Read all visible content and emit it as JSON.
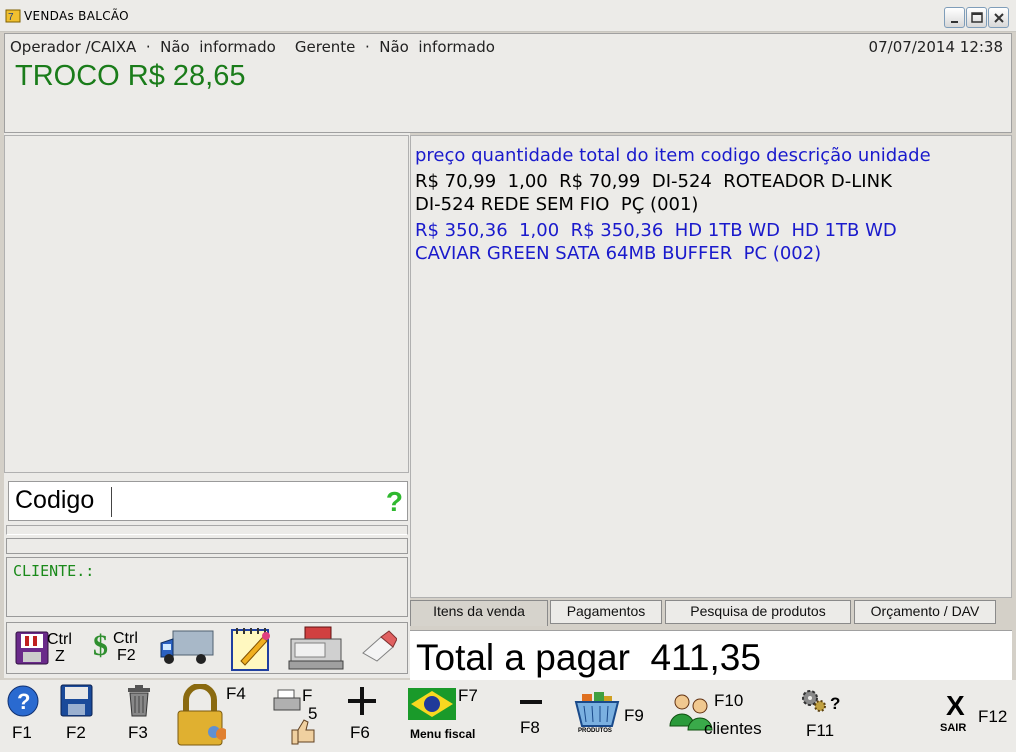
{
  "window": {
    "title": "VENDAs BALCÃO",
    "controls": [
      "minimize",
      "maximize",
      "close"
    ]
  },
  "header": {
    "operator_info": "Operador /CAIXA  ·  Não  informado    Gerente  ·  Não  informado",
    "datetime": "07/07/2014  12:38",
    "troco": "TROCO R$ 28,65"
  },
  "items": {
    "header": "preço quantidade total do item codigo descrição unidade",
    "rows": [
      {
        "line1": "R$ 70,99  1,00  R$ 70,99  DI-524  ROTEADOR D-LINK",
        "line2": "DI-524 REDE SEM FIO  PÇ (001)"
      },
      {
        "line1": "R$ 350,36  1,00  R$ 350,36  HD 1TB WD  HD 1TB WD",
        "line2": "CAVIAR GREEN SATA 64MB BUFFER  PC (002)"
      }
    ]
  },
  "tabs": [
    "Itens da venda",
    "Pagamentos",
    "Pesquisa de produtos",
    "Orçamento / DAV"
  ],
  "total": {
    "label": "Total a pagar  411,35"
  },
  "codigo": {
    "label": "Codigo",
    "help": "?"
  },
  "cliente": {
    "label": "CLIENTE.:"
  },
  "left_toolbar": {
    "ctrl_z": [
      "Ctrl",
      "Z"
    ],
    "ctrl_f2": [
      "Ctrl",
      "F2"
    ]
  },
  "fkeys": {
    "f1": "F1",
    "f2": "F2",
    "f3": "F3",
    "f4": "F4",
    "f5_top": "F",
    "f5_bottom": "5",
    "f6": "F6",
    "f7": "F7",
    "f7_caption": "Menu fiscal",
    "f8": "F8",
    "f9": "F9",
    "f9_caption": "PRODUTOS",
    "f10": "F10",
    "f10_caption": "clientes",
    "f11": "F11",
    "f11_q": "?",
    "f12": "F12",
    "f12_x": "X",
    "f12_caption": "SAIR"
  },
  "colors": {
    "troco": "#1a7c1a",
    "item_blue": "#1a1acc",
    "help": "#2fb82f"
  }
}
